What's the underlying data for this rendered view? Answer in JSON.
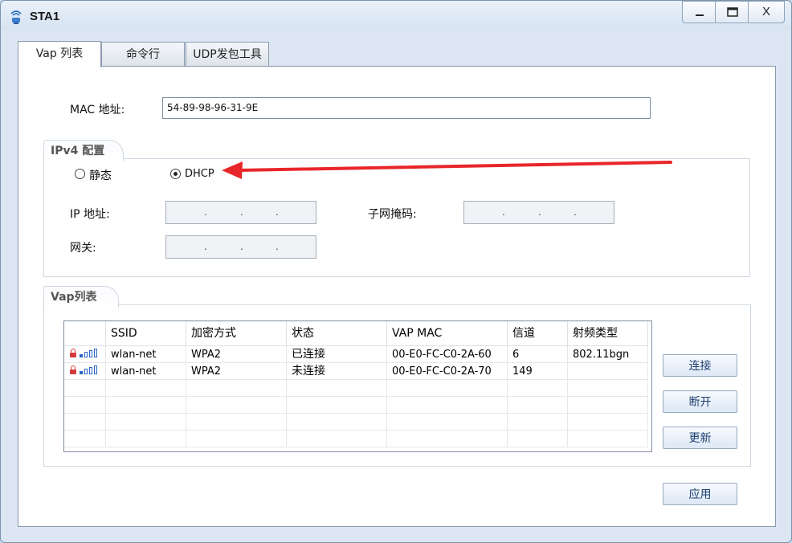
{
  "window": {
    "title": "STA1",
    "minimize": "_",
    "close": "X"
  },
  "tabs": [
    {
      "label": "Vap 列表"
    },
    {
      "label": "命令行"
    },
    {
      "label": "UDP发包工具"
    }
  ],
  "mac": {
    "label": "MAC 地址:",
    "value": "54-89-98-96-31-9E"
  },
  "ipv4": {
    "group_title": "IPv4 配置",
    "static_label": "静态",
    "dhcp_label": "DHCP",
    "selected": "DHCP",
    "ip_label": "IP 地址:",
    "mask_label": "子网掩码:",
    "gateway_label": "网关:",
    "dot": "."
  },
  "vap": {
    "group_title": "Vap列表",
    "columns": [
      "SSID",
      "加密方式",
      "状态",
      "VAP MAC",
      "信道",
      "射频类型"
    ],
    "rows": [
      {
        "ssid": "wlan-net",
        "enc": "WPA2",
        "status": "已连接",
        "mac": "00-E0-FC-C0-2A-60",
        "channel": "6",
        "radio": "802.11bgn"
      },
      {
        "ssid": "wlan-net",
        "enc": "WPA2",
        "status": "未连接",
        "mac": "00-E0-FC-C0-2A-70",
        "channel": "149",
        "radio": ""
      }
    ]
  },
  "buttons": {
    "connect": "连接",
    "disconnect": "断开",
    "refresh": "更新",
    "apply": "应用"
  },
  "annotation": {
    "arrow_color": "#e8262a"
  }
}
